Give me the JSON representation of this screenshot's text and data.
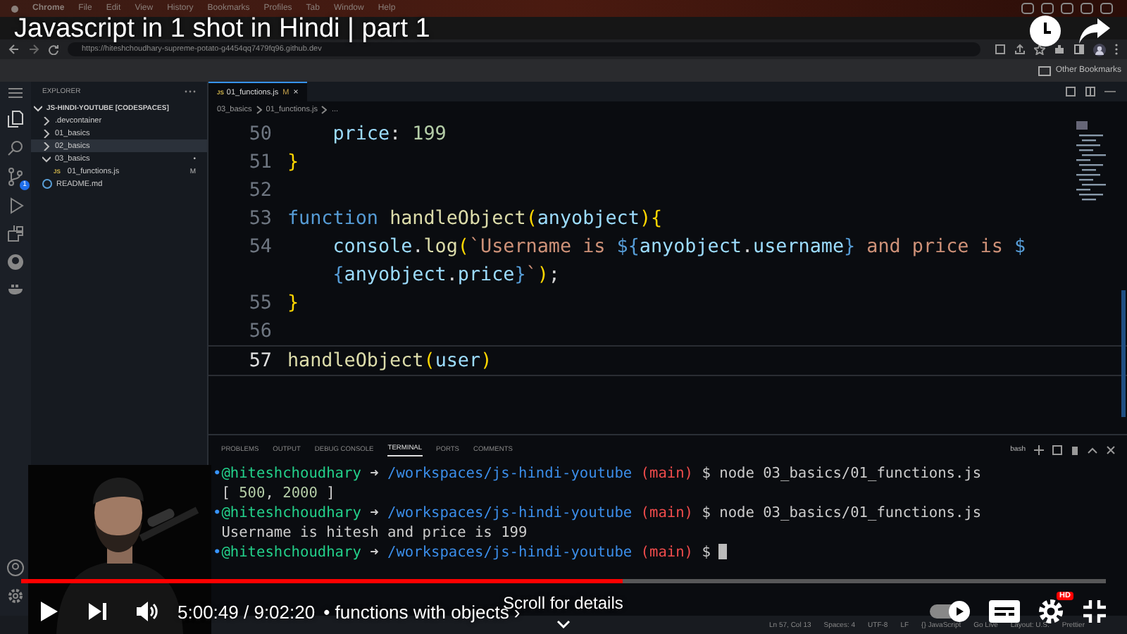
{
  "menubar": {
    "items": [
      "Chrome",
      "File",
      "Edit",
      "View",
      "History",
      "Bookmarks",
      "Profiles",
      "Tab",
      "Window",
      "Help"
    ]
  },
  "browser": {
    "url": "https://hiteshchoudhary-supreme-potato-g4454qq7479fq96.github.dev",
    "bookmarks": [
      "Other Bookmarks"
    ]
  },
  "activity_bar": {
    "scm_badge": "1"
  },
  "explorer": {
    "title": "EXPLORER",
    "root": {
      "label": "JS-HINDI-YOUTUBE [CODESPACES]",
      "expanded": true,
      "children": [
        {
          "label": ".devcontainer",
          "kind": "folder",
          "expanded": false,
          "selected": false
        },
        {
          "label": "01_basics",
          "kind": "folder",
          "expanded": false,
          "selected": false
        },
        {
          "label": "02_basics",
          "kind": "folder",
          "expanded": false,
          "selected": true
        },
        {
          "label": "03_basics",
          "kind": "folder",
          "expanded": true,
          "selected": false,
          "badge": "•",
          "children": [
            {
              "label": "01_functions.js",
              "kind": "js",
              "icon": "JS",
              "selected": false,
              "badge": "M"
            }
          ]
        },
        {
          "label": "README.md",
          "kind": "md",
          "selected": false
        }
      ]
    }
  },
  "editor": {
    "tab": {
      "icon": "JS",
      "label": "01_functions.js",
      "badge": "M",
      "close": "×",
      "selected": true
    },
    "breadcrumbs": [
      "03_basics",
      "01_functions.js",
      "..."
    ],
    "lines": [
      {
        "number": "50",
        "current": false,
        "indented": true,
        "tokens": [
          {
            "kind": "prop",
            "text": "price"
          },
          {
            "kind": "plain",
            "text": ": "
          },
          {
            "kind": "num",
            "text": "199"
          }
        ]
      },
      {
        "number": "51",
        "current": false,
        "indented": false,
        "tokens": [
          {
            "kind": "brace",
            "text": "}"
          }
        ]
      },
      {
        "number": "52",
        "current": false
      },
      {
        "number": "53",
        "current": false,
        "indented": false,
        "tokens": [
          {
            "kind": "kw",
            "text": "function "
          },
          {
            "kind": "fn",
            "text": "handleObject"
          },
          {
            "kind": "brace",
            "text": "("
          },
          {
            "kind": "prop",
            "text": "anyobject"
          },
          {
            "kind": "brace",
            "text": "){"
          }
        ]
      },
      {
        "number": "54",
        "current": false,
        "indented": true,
        "tokens": [
          {
            "kind": "prop",
            "text": "console"
          },
          {
            "kind": "plain",
            "text": "."
          },
          {
            "kind": "fn",
            "text": "log"
          },
          {
            "kind": "brace",
            "text": "("
          },
          {
            "kind": "str",
            "text": "`Username is "
          },
          {
            "kind": "kw",
            "text": "${"
          },
          {
            "kind": "prop",
            "text": "anyobject"
          },
          {
            "kind": "plain",
            "text": "."
          },
          {
            "kind": "prop",
            "text": "username"
          },
          {
            "kind": "kw",
            "text": "}"
          },
          {
            "kind": "str",
            "text": " and price is "
          },
          {
            "kind": "kw",
            "text": "$"
          }
        ]
      },
      {
        "current": false,
        "indented": true,
        "tokens": [
          {
            "kind": "kw",
            "text": "{"
          },
          {
            "kind": "prop",
            "text": "anyobject"
          },
          {
            "kind": "plain",
            "text": "."
          },
          {
            "kind": "prop",
            "text": "price"
          },
          {
            "kind": "kw",
            "text": "}"
          },
          {
            "kind": "str",
            "text": "`"
          },
          {
            "kind": "brace",
            "text": ")"
          },
          {
            "kind": "plain",
            "text": ";"
          }
        ]
      },
      {
        "number": "55",
        "current": false,
        "indented": false,
        "tokens": [
          {
            "kind": "brace",
            "text": "}"
          }
        ]
      },
      {
        "number": "56",
        "current": false
      },
      {
        "number": "57",
        "current": true,
        "indented": false,
        "tokens": [
          {
            "kind": "fn",
            "text": "handleObject"
          },
          {
            "kind": "brace",
            "text": "("
          },
          {
            "kind": "prop",
            "text": "user"
          },
          {
            "kind": "brace",
            "text": ")"
          }
        ]
      }
    ]
  },
  "panel": {
    "tabs": [
      {
        "label": "PROBLEMS",
        "selected": false
      },
      {
        "label": "OUTPUT",
        "selected": false
      },
      {
        "label": "DEBUG CONSOLE",
        "selected": false
      },
      {
        "label": "TERMINAL",
        "selected": true
      },
      {
        "label": "PORTS",
        "selected": false
      },
      {
        "label": "COMMENTS",
        "selected": false
      }
    ],
    "shell": "bash",
    "terminal": [
      {
        "cursor": false,
        "tokens": [
          {
            "kind": "dot",
            "text": "•"
          },
          {
            "kind": "user",
            "text": "@hiteshchoudhary"
          },
          {
            "kind": "out",
            "text": " ➜ "
          },
          {
            "kind": "path",
            "text": "/workspaces/js-hindi-youtube"
          },
          {
            "kind": "branch",
            "text": " (main)"
          },
          {
            "kind": "out",
            "text": " $ node 03_basics/01_functions.js"
          }
        ]
      },
      {
        "cursor": false,
        "tokens": [
          {
            "kind": "out",
            "text": " [ "
          },
          {
            "kind": "num",
            "text": "500"
          },
          {
            "kind": "out",
            "text": ", "
          },
          {
            "kind": "num",
            "text": "2000"
          },
          {
            "kind": "out",
            "text": " ]"
          }
        ]
      },
      {
        "cursor": false,
        "tokens": [
          {
            "kind": "dot",
            "text": "•"
          },
          {
            "kind": "user",
            "text": "@hiteshchoudhary"
          },
          {
            "kind": "out",
            "text": " ➜ "
          },
          {
            "kind": "path",
            "text": "/workspaces/js-hindi-youtube"
          },
          {
            "kind": "branch",
            "text": " (main)"
          },
          {
            "kind": "out",
            "text": " $ node 03_basics/01_functions.js"
          }
        ]
      },
      {
        "cursor": false,
        "tokens": [
          {
            "kind": "out",
            "text": " Username is hitesh and price is 199"
          }
        ]
      },
      {
        "cursor": true,
        "tokens": [
          {
            "kind": "dot",
            "text": "•"
          },
          {
            "kind": "user",
            "text": "@hiteshchoudhary"
          },
          {
            "kind": "out",
            "text": " ➜ "
          },
          {
            "kind": "path",
            "text": "/workspaces/js-hindi-youtube"
          },
          {
            "kind": "branch",
            "text": " (main)"
          },
          {
            "kind": "out",
            "text": " $"
          }
        ]
      }
    ]
  },
  "status_bar": [
    "Ln 57, Col 13",
    "Spaces: 4",
    "UTF-8",
    "LF",
    "{} JavaScript",
    "Go Live",
    "Layout: U.S.",
    "Prettier"
  ],
  "video": {
    "title": "Javascript in 1 shot in Hindi | part 1",
    "time": "5:00:49 / 9:02:20",
    "chapter": "• functions with objects ›",
    "hint": "Scroll for details",
    "level": 0.555,
    "quality_badge": "HD",
    "autoplay": true
  }
}
